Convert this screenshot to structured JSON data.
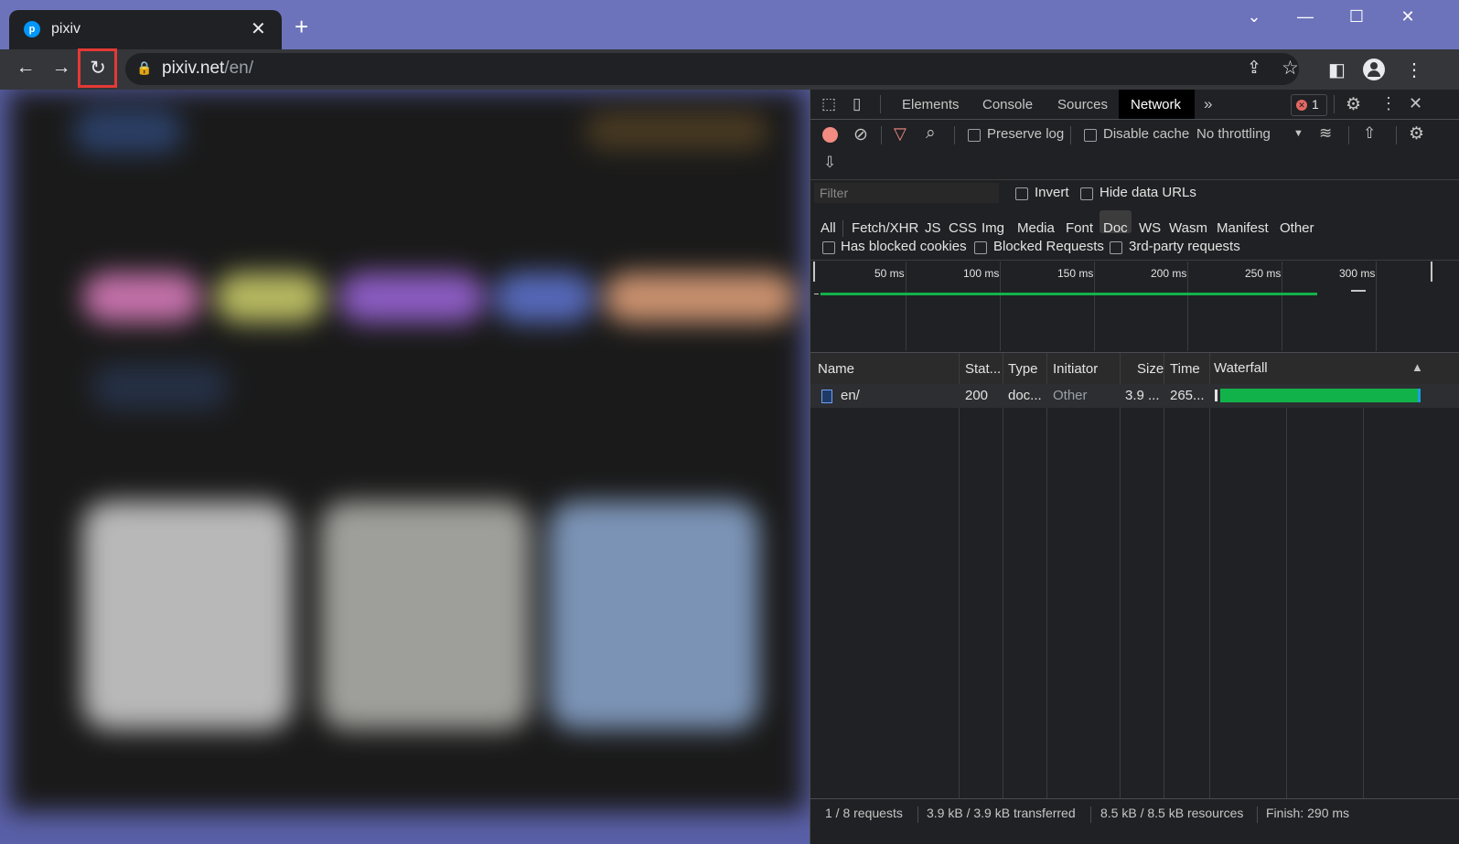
{
  "browser": {
    "tab_title": "pixiv",
    "favicon_letter": "p",
    "url_host": "pixiv.net",
    "url_path": "/en/"
  },
  "devtools": {
    "tabs": [
      "Elements",
      "Console",
      "Sources",
      "Network"
    ],
    "active_tab": "Network",
    "error_count": "1",
    "toolbar": {
      "preserve_log": "Preserve log",
      "disable_cache": "Disable cache",
      "throttling": "No throttling"
    },
    "filter_placeholder": "Filter",
    "invert_label": "Invert",
    "hide_data_urls_label": "Hide data URLs",
    "type_filters": [
      "All",
      "Fetch/XHR",
      "JS",
      "CSS",
      "Img",
      "Media",
      "Font",
      "Doc",
      "WS",
      "Wasm",
      "Manifest",
      "Other"
    ],
    "active_type_filter": "Doc",
    "has_blocked_cookies": "Has blocked cookies",
    "blocked_requests": "Blocked Requests",
    "third_party": "3rd-party requests",
    "timeline_ticks": [
      "50 ms",
      "100 ms",
      "150 ms",
      "200 ms",
      "250 ms",
      "300 ms"
    ],
    "columns": [
      "Name",
      "Stat...",
      "Type",
      "Initiator",
      "Size",
      "Time",
      "Waterfall"
    ],
    "rows": [
      {
        "name": "en/",
        "status": "200",
        "type": "doc...",
        "initiator": "Other",
        "size": "3.9 ...",
        "time": "265..."
      }
    ],
    "status_bar": {
      "requests": "1 / 8 requests",
      "transferred": "3.9 kB / 3.9 kB transferred",
      "resources": "8.5 kB / 8.5 kB resources",
      "finish": "Finish: 290 ms"
    }
  },
  "colors": {
    "accent_green": "#12b24a",
    "record_red": "#f28b82",
    "highlight_box": "#e53935"
  }
}
